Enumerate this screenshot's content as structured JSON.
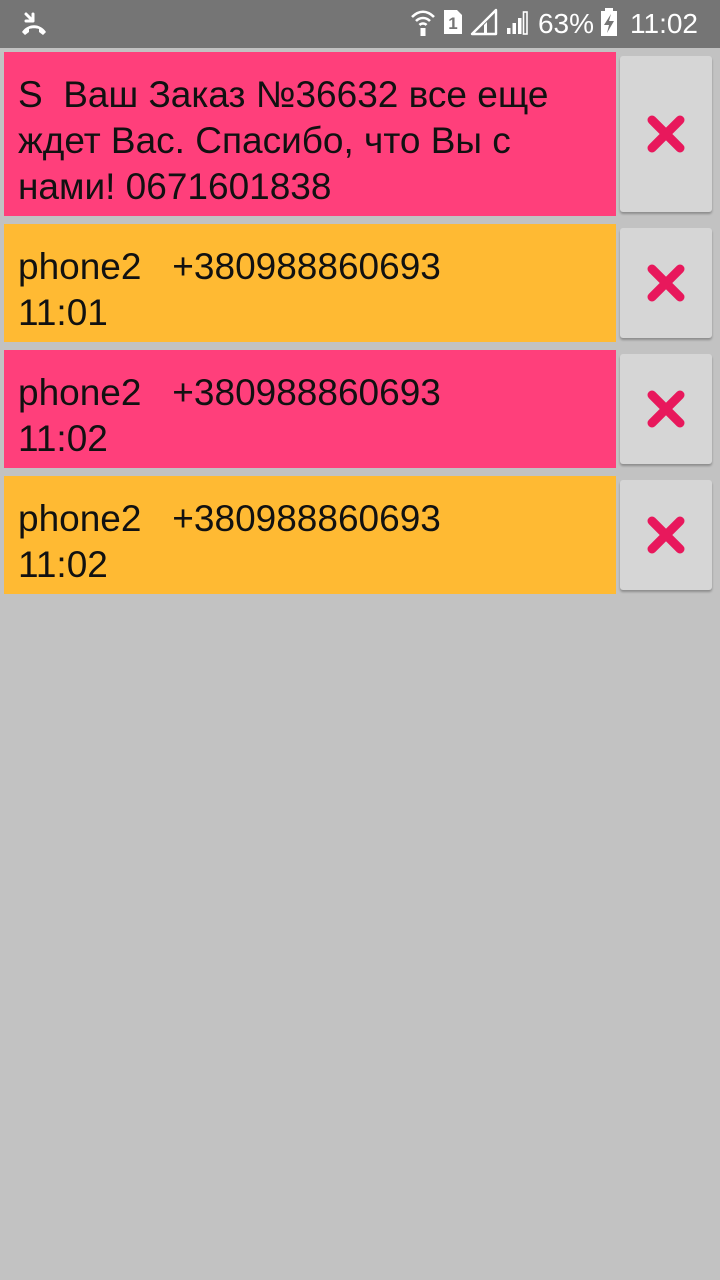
{
  "status_bar": {
    "left_icon": "missed-call-icon",
    "wifi_icon": "wifi-icon",
    "sim_badge": "1",
    "signal_icons": [
      "signal-1-icon",
      "signal-2-icon"
    ],
    "battery_percent": "63%",
    "battery_icon": "battery-charging-icon",
    "time": "11:02"
  },
  "colors": {
    "pink": "#ff3f7b",
    "orange": "#ffba33",
    "background": "#c2c2c2",
    "status_bar": "#757575",
    "delete_icon": "#e8185c"
  },
  "messages": [
    {
      "text": "S  Ваш Заказ №36632 все еще ждет Вас. Спасибо, что Вы с нами! 0671601838",
      "color": "pink",
      "delete_icon": "close-icon"
    },
    {
      "text": "phone2   +380988860693\n11:01",
      "color": "orange",
      "delete_icon": "close-icon"
    },
    {
      "text": "phone2   +380988860693\n11:02",
      "color": "pink",
      "delete_icon": "close-icon"
    },
    {
      "text": "phone2   +380988860693\n11:02",
      "color": "orange",
      "delete_icon": "close-icon"
    }
  ]
}
